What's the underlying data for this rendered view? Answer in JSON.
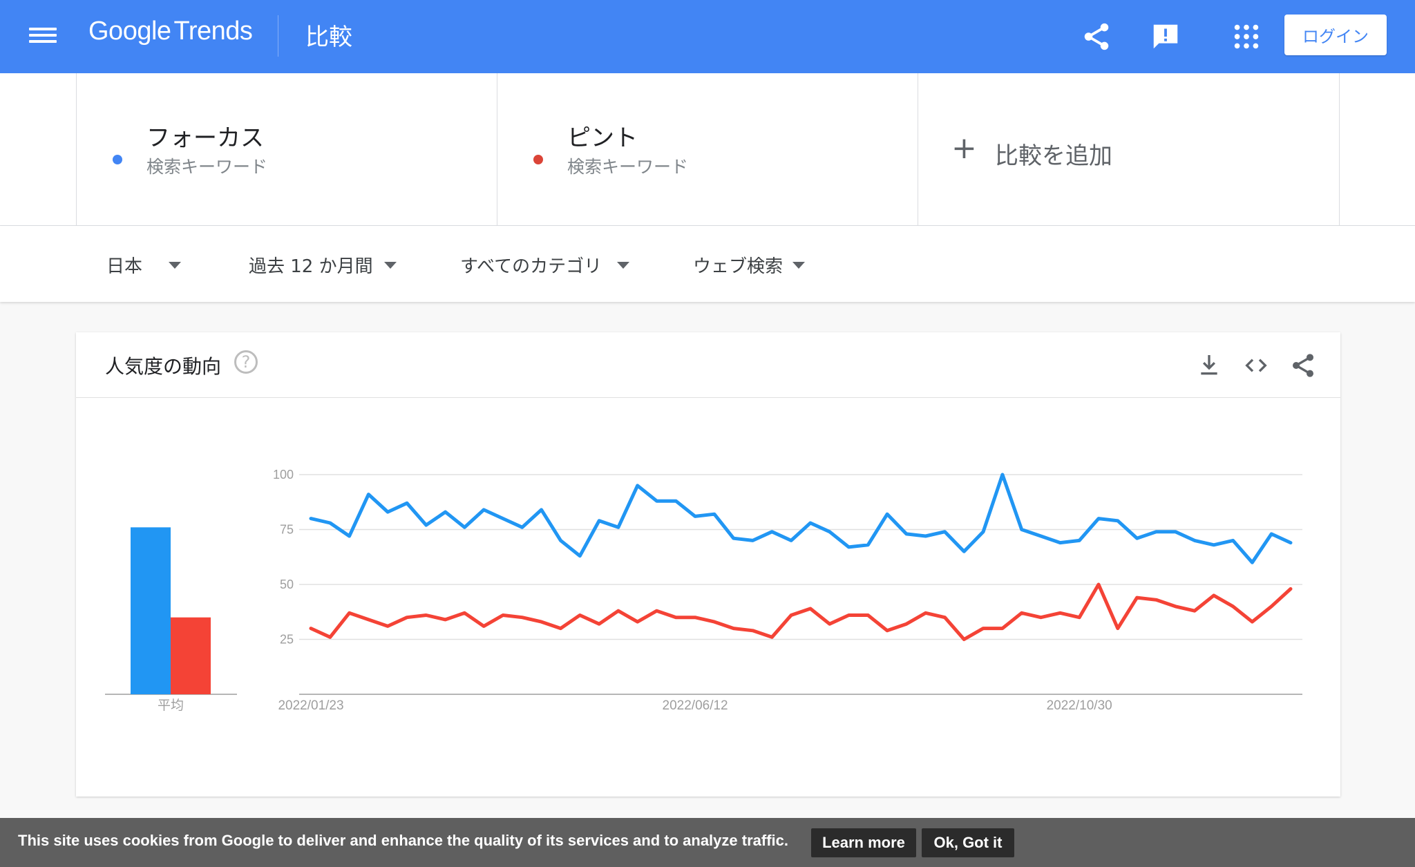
{
  "header": {
    "logo_google": "Google",
    "logo_trends": "Trends",
    "title": "比較",
    "login_label": "ログイン",
    "icons": [
      "menu-icon",
      "share-icon",
      "feedback-icon",
      "apps-grid-icon"
    ]
  },
  "compare": {
    "terms": [
      {
        "name": "フォーカス",
        "type": "検索キーワード",
        "color": "#4285f4"
      },
      {
        "name": "ピント",
        "type": "検索キーワード",
        "color": "#db4437"
      }
    ],
    "add_label": "比較を追加",
    "add_icon": "plus-icon"
  },
  "filters": {
    "region": "日本",
    "period": "過去 12 か月間",
    "category": "すべてのカテゴリ",
    "search_type": "ウェブ検索"
  },
  "card": {
    "title": "人気度の動向",
    "help_symbol": "?",
    "icons": [
      "download-icon",
      "embed-code-icon",
      "share-icon"
    ]
  },
  "chart_data": {
    "type": "line",
    "ylim": [
      0,
      100
    ],
    "yticks": [
      25,
      50,
      75,
      100
    ],
    "x_tick_labels": [
      "2022/01/23",
      "2022/06/12",
      "2022/10/30"
    ],
    "x_tick_indices": [
      0,
      20,
      40
    ],
    "series": [
      {
        "name": "フォーカス",
        "color": "#2196f3",
        "values": [
          80,
          78,
          72,
          91,
          83,
          87,
          77,
          83,
          76,
          84,
          80,
          76,
          84,
          70,
          63,
          79,
          76,
          95,
          88,
          88,
          81,
          82,
          71,
          70,
          74,
          70,
          78,
          74,
          67,
          68,
          82,
          73,
          72,
          74,
          65,
          74,
          100,
          75,
          72,
          69,
          70,
          80,
          79,
          71,
          74,
          74,
          70,
          68,
          70,
          60,
          73,
          69
        ]
      },
      {
        "name": "ピント",
        "color": "#f44336",
        "values": [
          30,
          26,
          37,
          34,
          31,
          35,
          36,
          34,
          37,
          31,
          36,
          35,
          33,
          30,
          36,
          32,
          38,
          33,
          38,
          35,
          35,
          33,
          30,
          29,
          26,
          36,
          39,
          32,
          36,
          36,
          29,
          32,
          37,
          35,
          25,
          30,
          30,
          37,
          35,
          37,
          35,
          50,
          30,
          44,
          43,
          40,
          38,
          45,
          40,
          33,
          40,
          48
        ]
      }
    ],
    "averages": {
      "label": "平均",
      "values": [
        76,
        35
      ]
    }
  },
  "cookie": {
    "text": "This site uses cookies from Google to deliver and enhance the quality of its services and to analyze traffic.",
    "learn_more": "Learn more",
    "ok": "Ok, Got it"
  }
}
